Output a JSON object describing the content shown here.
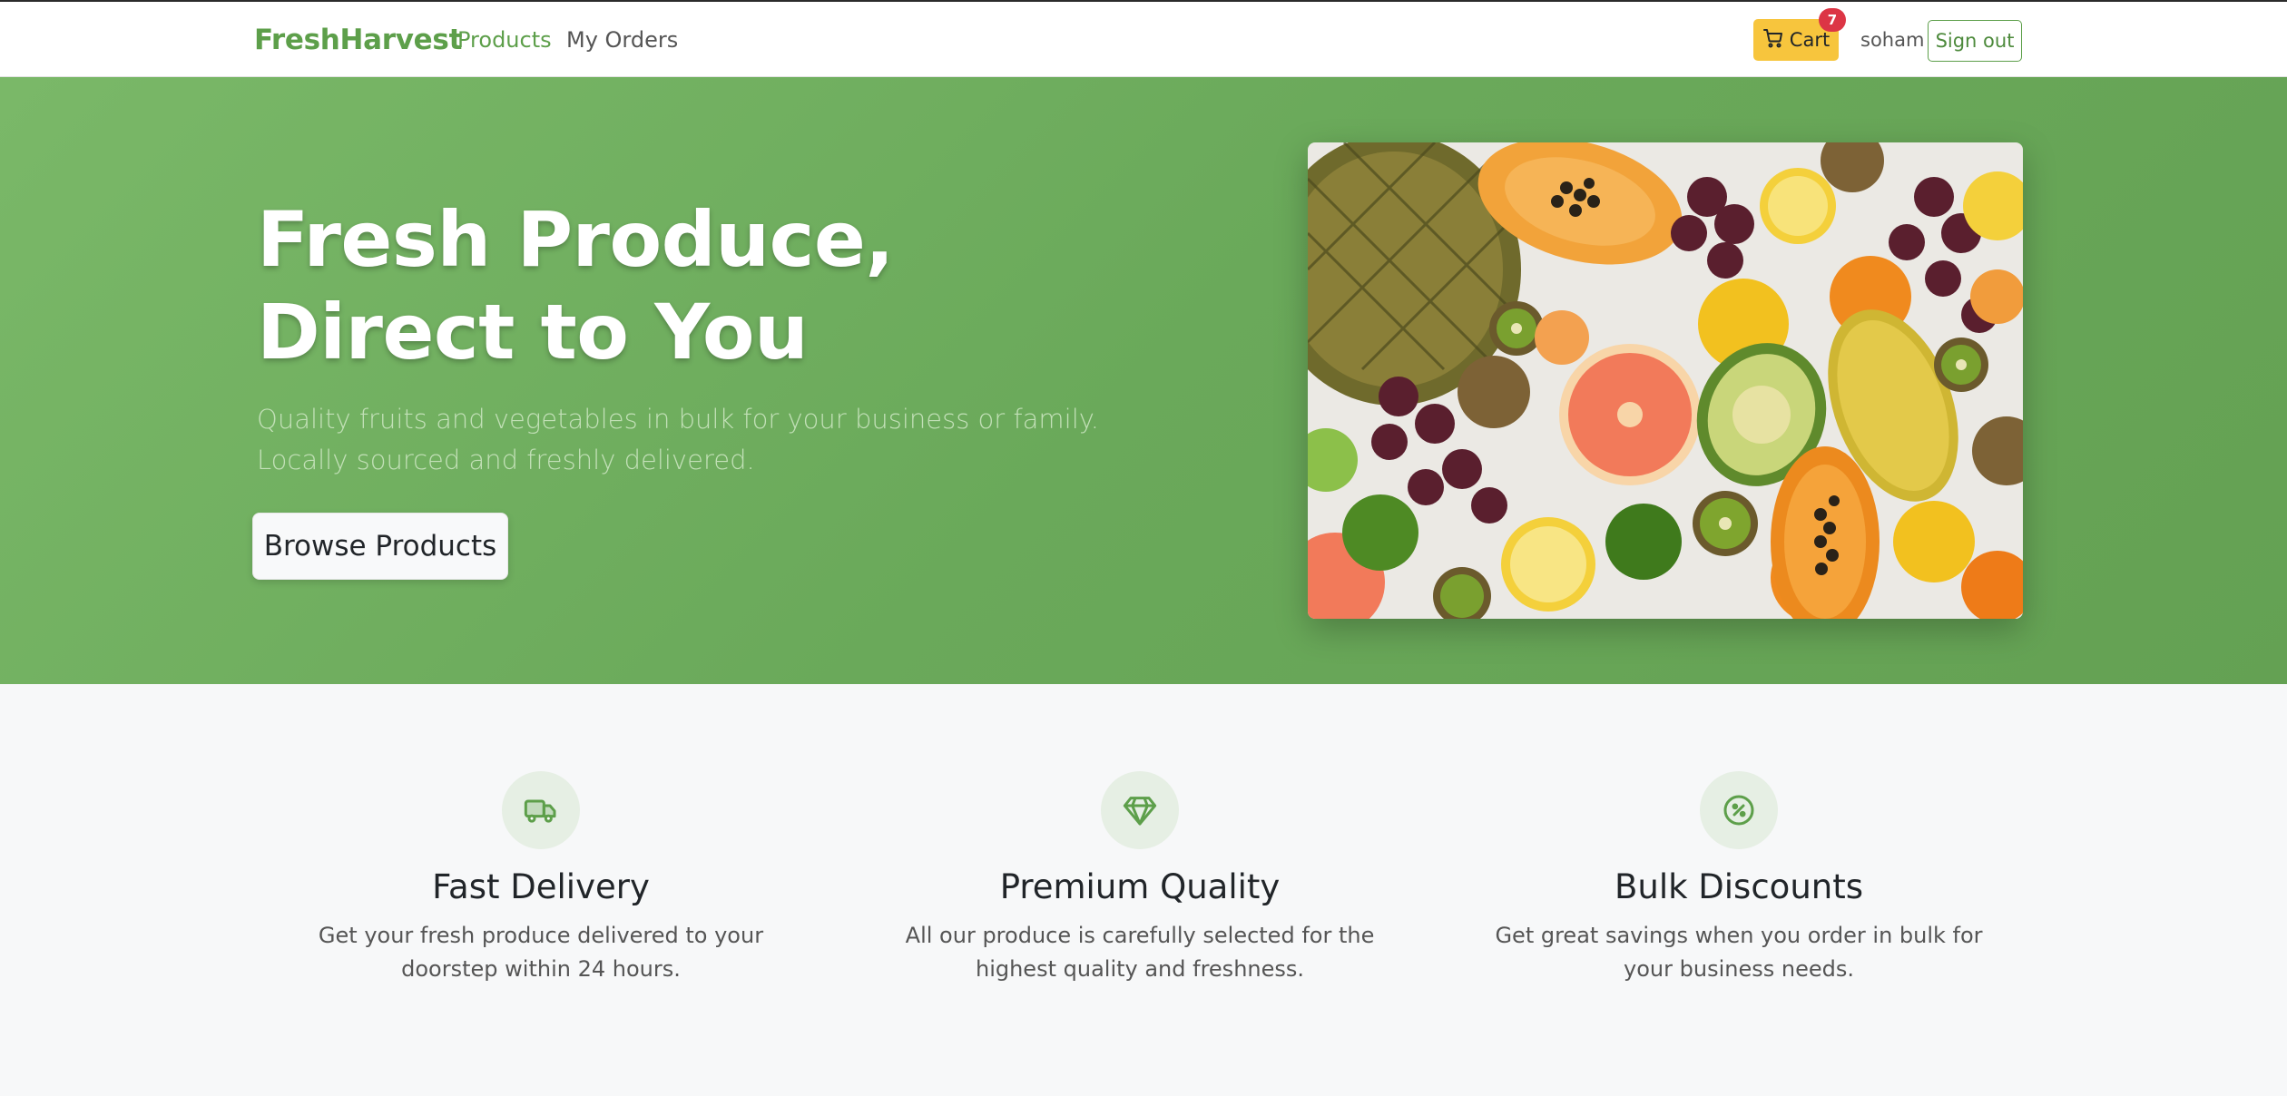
{
  "navbar": {
    "brand": "FreshHarvest",
    "links": [
      {
        "label": "Products",
        "active": true
      },
      {
        "label": "My Orders",
        "active": false
      }
    ],
    "cart": {
      "label": "Cart",
      "count": "7",
      "icon": "cart-icon"
    },
    "username": "soham",
    "signout_label": "Sign out"
  },
  "hero": {
    "title": "Fresh Produce, Direct to You",
    "subtitle": "Quality fruits and vegetables in bulk for your business or family. Locally sourced and freshly delivered.",
    "cta_label": "Browse Products",
    "image_alt": "assorted fruits"
  },
  "features": [
    {
      "icon": "truck-icon",
      "title": "Fast Delivery",
      "description": "Get your fresh produce delivered to your doorstep within 24 hours."
    },
    {
      "icon": "gem-icon",
      "title": "Premium Quality",
      "description": "All our produce is carefully selected for the highest quality and freshness."
    },
    {
      "icon": "percent-icon",
      "title": "Bulk Discounts",
      "description": "Get great savings when you order in bulk for your business needs."
    }
  ],
  "colors": {
    "brand_green": "#5d9f4a",
    "hero_green": "#6aa95a",
    "cart_yellow": "#f7c53d",
    "badge_red": "#dc3545"
  }
}
